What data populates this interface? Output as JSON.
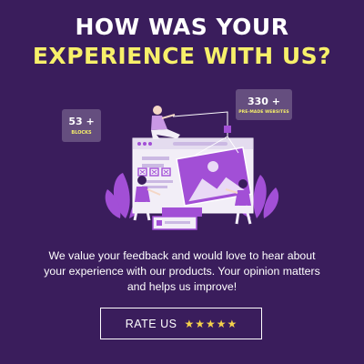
{
  "headline": {
    "line1": "HOW WAS YOUR",
    "line2": "EXPERIENCE WITH US?"
  },
  "badges": {
    "blocks": {
      "number": "53 +",
      "label": "BLOCKS"
    },
    "websites": {
      "number": "330 +",
      "label": "PRE-MADE WEBSITES"
    }
  },
  "message": "We value your feedback and would love to hear about your experience with our products. Your opinion matters and helps us improve!",
  "rate_button": {
    "label": "RATE US",
    "star_icon": "star-icon",
    "rating": 5
  },
  "colors": {
    "background": "#3a1d5c",
    "accent_yellow": "#f7f06a",
    "illustration_purple": "#a24fd6",
    "star": "#f6d24b"
  }
}
